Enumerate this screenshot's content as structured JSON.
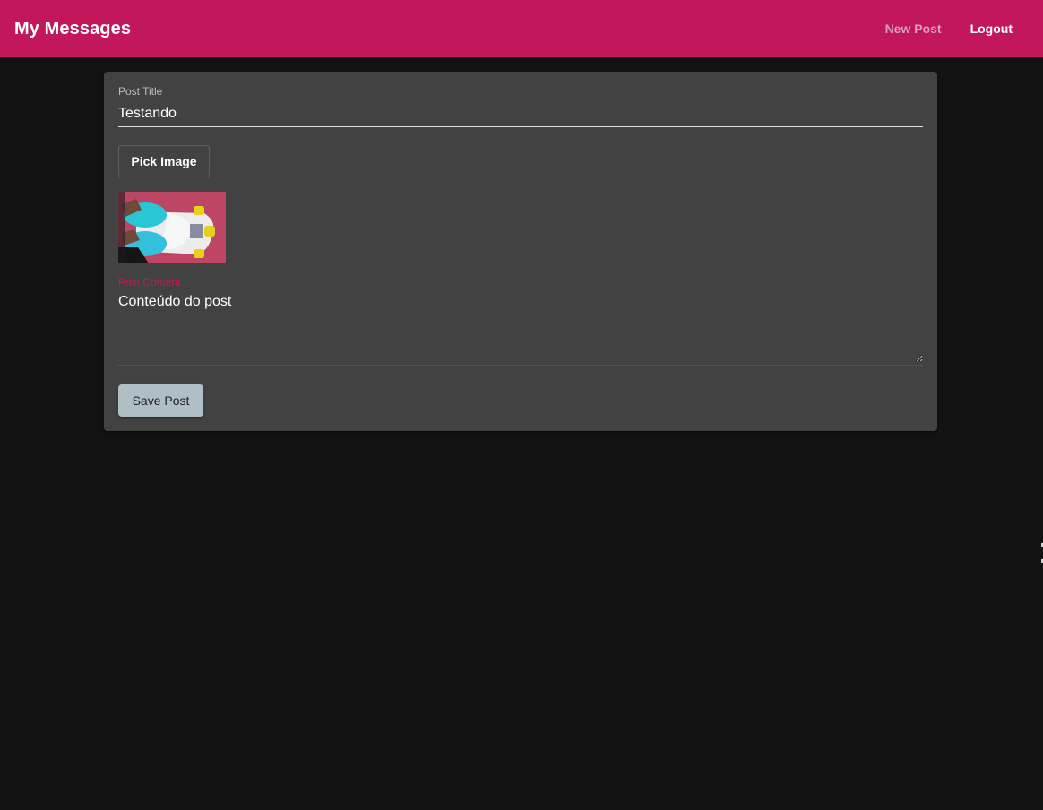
{
  "toolbar": {
    "title": "My Messages",
    "nav": [
      {
        "label": "New Post",
        "active": true
      },
      {
        "label": "Logout",
        "active": false
      }
    ],
    "color": "#c2185b"
  },
  "form": {
    "title_field": {
      "label": "Post Title",
      "value": "Testando"
    },
    "pick_image_label": "Pick Image",
    "image_preview": "skateboard-photo",
    "content_field": {
      "label": "Post Content",
      "value": "Conteúdo do post"
    },
    "save_label": "Save Post"
  },
  "colors": {
    "background": "#121212",
    "card": "#424242",
    "accent": "#c2185b",
    "save_button": "#b0bec5"
  }
}
